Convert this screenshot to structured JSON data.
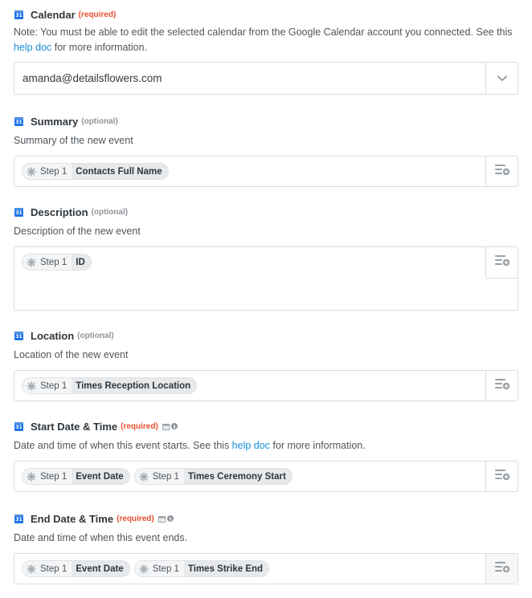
{
  "fields": {
    "calendar": {
      "icon": "google-calendar-icon",
      "icon_text": "31",
      "label": "Calendar",
      "tag": "(required)",
      "help_before": "Note: You must be able to edit the selected calendar from the Google Calendar account you connected. See this ",
      "help_link": "help doc",
      "help_after": " for more information.",
      "value": "amanda@detailsflowers.com"
    },
    "summary": {
      "icon_text": "31",
      "label": "Summary",
      "tag": "(optional)",
      "help": "Summary of the new event",
      "pills": [
        {
          "step": "Step 1",
          "value": "Contacts Full Name"
        }
      ]
    },
    "description": {
      "icon_text": "31",
      "label": "Description",
      "tag": "(optional)",
      "help": "Description of the new event",
      "pills": [
        {
          "step": "Step 1",
          "value": "ID"
        }
      ]
    },
    "location": {
      "icon_text": "31",
      "label": "Location",
      "tag": "(optional)",
      "help": "Location of the new event",
      "pills": [
        {
          "step": "Step 1",
          "value": "Times Reception Location"
        }
      ]
    },
    "start": {
      "icon_text": "31",
      "label": "Start Date & Time",
      "tag": "(required)",
      "help_before": "Date and time of when this event starts. See this ",
      "help_link": "help doc",
      "help_after": " for more information.",
      "pills": [
        {
          "step": "Step 1",
          "value": "Event Date"
        },
        {
          "step": "Step 1",
          "value": "Times Ceremony Start"
        }
      ]
    },
    "end": {
      "icon_text": "31",
      "label": "End Date & Time",
      "tag": "(required)",
      "help": "Date and time of when this event ends.",
      "pills": [
        {
          "step": "Step 1",
          "value": "Event Date"
        },
        {
          "step": "Step 1",
          "value": "Times Strike End"
        }
      ]
    }
  },
  "colors": {
    "required": "#e54e2f",
    "optional": "#8f959a",
    "link": "#1a8fd6",
    "calendar_icon": "#1e73e8"
  }
}
